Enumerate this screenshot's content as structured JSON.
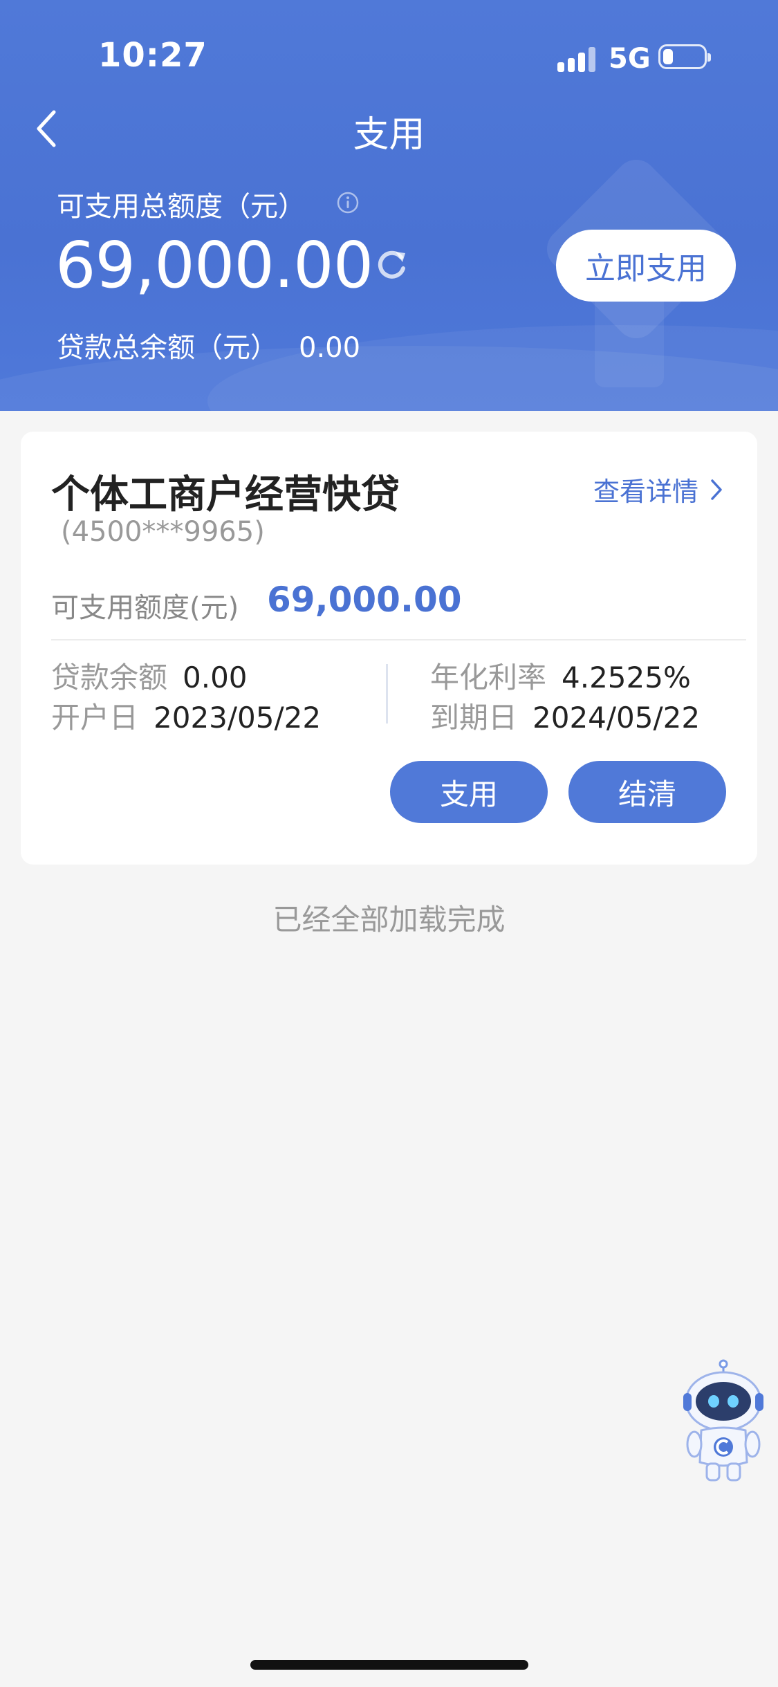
{
  "status_bar": {
    "time": "10:27",
    "network": "5G"
  },
  "nav": {
    "title": "支用"
  },
  "summary": {
    "total_label": "可支用总额度（元）",
    "total_amount": "69,000.00",
    "use_now_label": "立即支用",
    "loan_balance_label": "贷款总余额（元）",
    "loan_balance_value": "0.00"
  },
  "product": {
    "name": "个体工商户经营快贷",
    "account": "(4500***9965)",
    "detail_link": "查看详情",
    "available_label": "可支用额度(元)",
    "available_value": "69,000.00",
    "fields": {
      "balance_label": "贷款余额",
      "balance_value": "0.00",
      "open_date_label": "开户日",
      "open_date_value": "2023/05/22",
      "rate_label": "年化利率",
      "rate_value": "4.2525%",
      "due_date_label": "到期日",
      "due_date_value": "2024/05/22"
    },
    "use_button": "支用",
    "settle_button": "结清"
  },
  "footer": {
    "loaded_text": "已经全部加载完成"
  },
  "colors": {
    "primary": "#4a72d3",
    "header_bg": "#5079d8",
    "page_bg": "#f5f5f5"
  },
  "icons": [
    "back-icon",
    "info-icon",
    "refresh-icon",
    "chevron-right-icon",
    "assistant-robot-icon"
  ]
}
